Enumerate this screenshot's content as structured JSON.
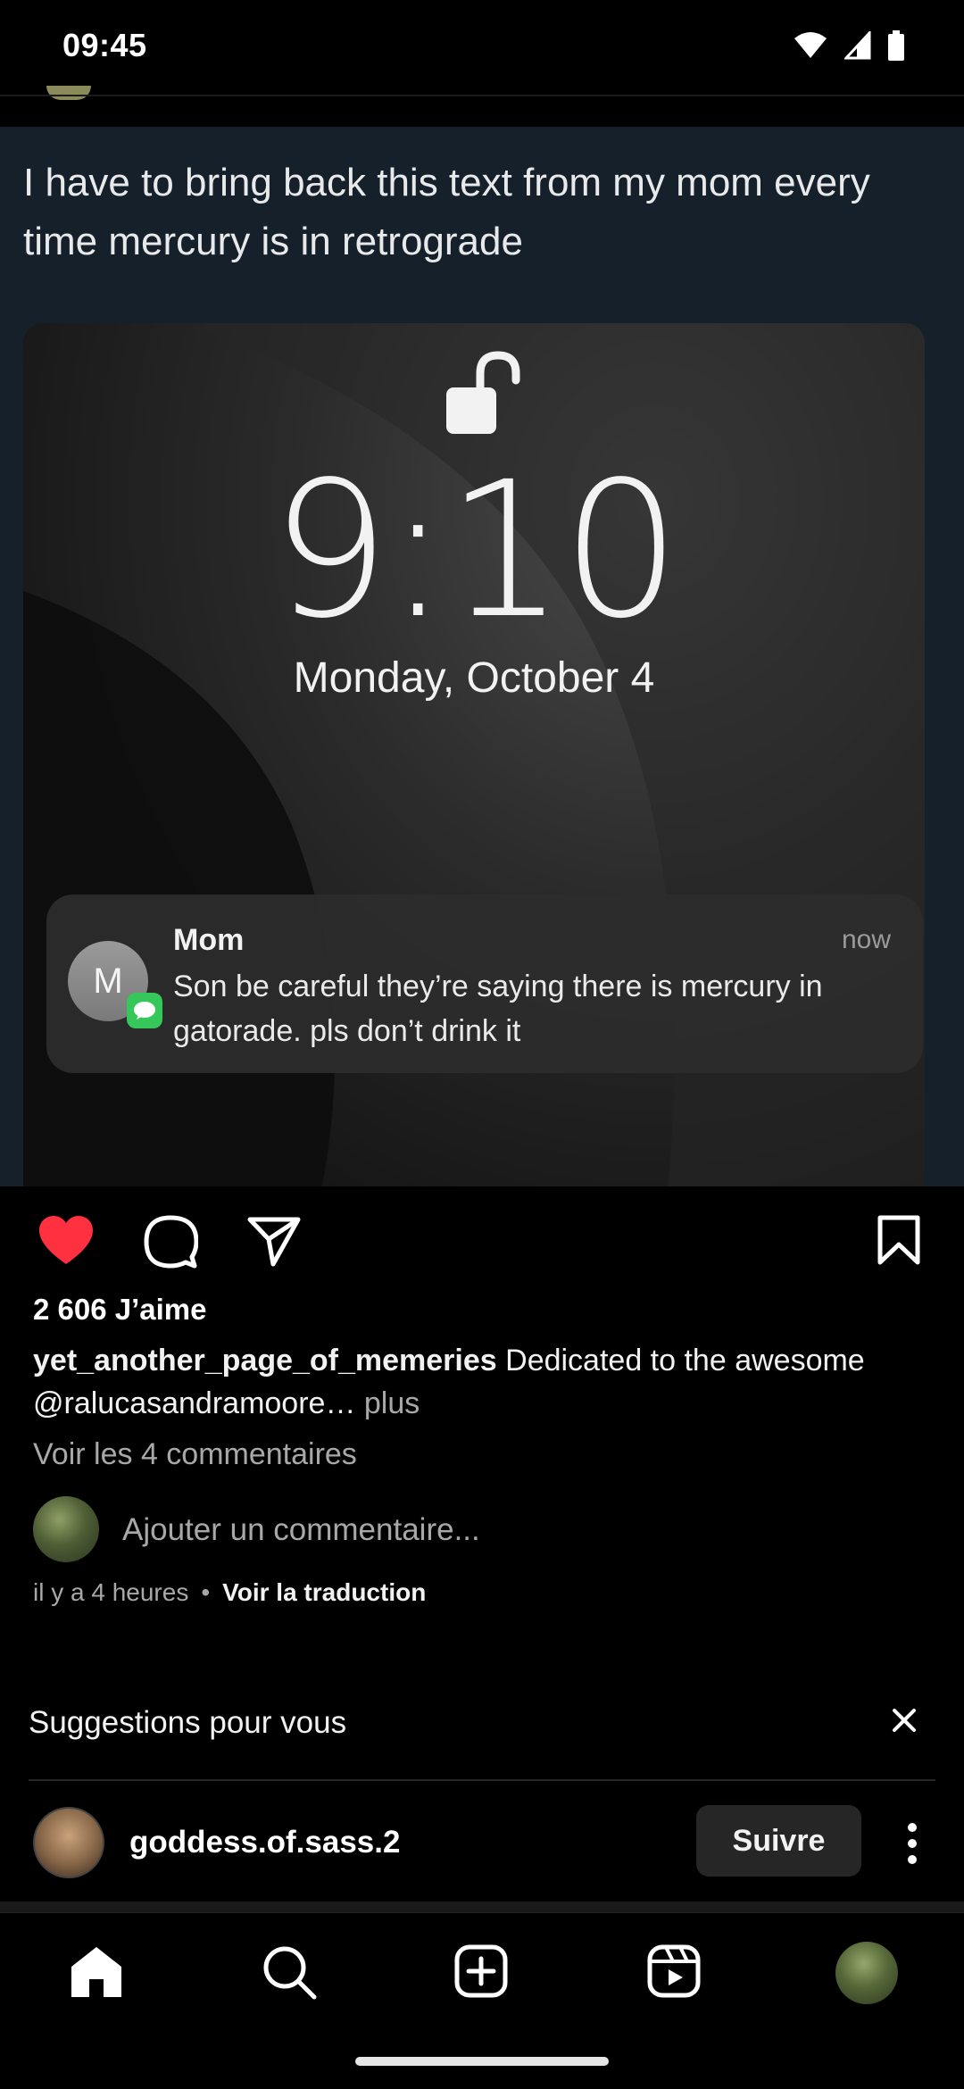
{
  "status_bar": {
    "time": "09:45"
  },
  "post": {
    "tweet_text": "I have to bring back this text from my mom every time mercury is in retrograde",
    "lockscreen": {
      "time": "9:10",
      "date": "Monday, October 4",
      "notification": {
        "avatar_initial": "M",
        "sender": "Mom",
        "timestamp": "now",
        "body": "Son be careful they’re saying there is mercury in gatorade. pls don’t drink it"
      }
    },
    "liked": true,
    "likes_text": "2 606 J’aime",
    "caption": {
      "username": "yet_another_page_of_memeries",
      "text": " Dedicated to the awesome @ralucasandramoore",
      "ellipsis": "…",
      "more": " plus"
    },
    "view_comments": "Voir les 4 commentaires",
    "comment_placeholder": "Ajouter un commentaire...",
    "time_ago": "il y a 4 heures",
    "separator": "•",
    "translate": "Voir la traduction"
  },
  "suggestions": {
    "title": "Suggestions pour vous",
    "items": [
      {
        "username": "goddess.of.sass.2",
        "follow_label": "Suivre"
      }
    ]
  },
  "bottom_nav": {
    "items": [
      "home-icon",
      "search-icon",
      "create-icon",
      "reels-icon",
      "profile-avatar"
    ]
  },
  "colors": {
    "background": "#000000",
    "like_red": "#ff3040",
    "tweet_bg": "#15202b",
    "muted_text": "#a8a8a8",
    "imessage_green": "#35c759"
  }
}
